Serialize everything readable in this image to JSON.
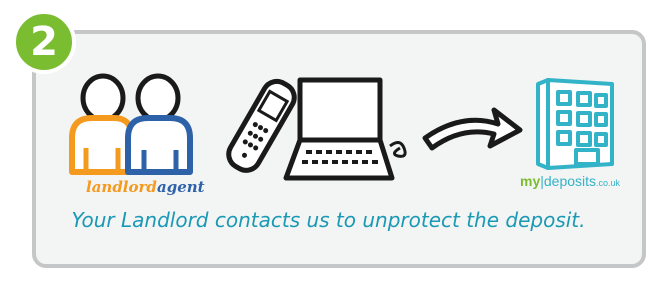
{
  "step": {
    "number": "2"
  },
  "labels": {
    "landlord": "landlord",
    "agent": "agent"
  },
  "logo": {
    "my": "my",
    "separator": "|",
    "name": "deposits",
    "tld": ".co.uk"
  },
  "caption": "Your Landlord contacts us to unprotect the deposit.",
  "colors": {
    "badge": "#7bbd31",
    "card_border": "#c5c6c8",
    "card_bg": "#f3f4f4",
    "landlord_orange": "#f39a1f",
    "agent_blue": "#2e62a8",
    "building_teal": "#33b3c8",
    "caption_teal": "#1a99b5"
  }
}
